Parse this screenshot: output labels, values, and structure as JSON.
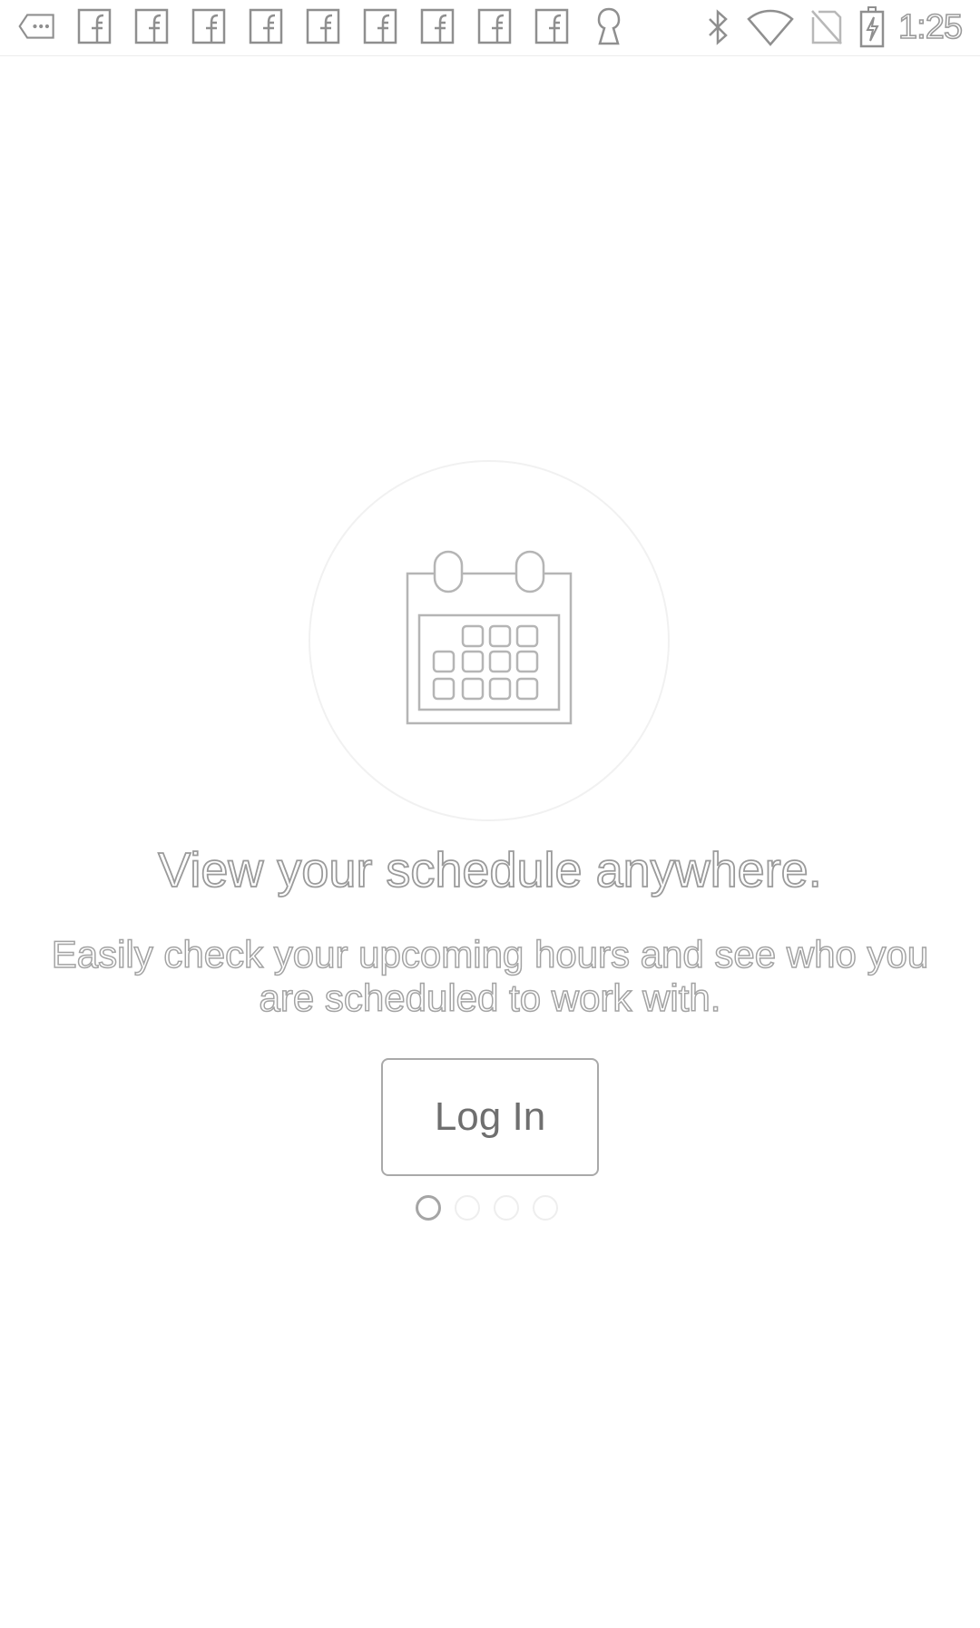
{
  "status_bar": {
    "notification_icons": [
      "more-notifications-icon",
      "facebook-icon",
      "facebook-icon",
      "facebook-icon",
      "facebook-icon",
      "facebook-icon",
      "facebook-icon",
      "facebook-icon",
      "facebook-icon",
      "facebook-icon",
      "keyhole-lock-icon"
    ],
    "system_icons": [
      "bluetooth-icon",
      "wifi-icon",
      "no-sim-icon",
      "battery-charging-icon"
    ],
    "time": "1:25"
  },
  "onboarding": {
    "hero_icon": "calendar-icon",
    "headline": "View your schedule anywhere.",
    "subtitle": "Easily check your upcoming hours and see who you are scheduled to work with.",
    "login_label": "Log In",
    "page_count": 4,
    "current_page": 1
  },
  "colors": {
    "background": "#ffffff",
    "outline_text": "#9b9b9b",
    "button_border": "#a9a9a9"
  }
}
